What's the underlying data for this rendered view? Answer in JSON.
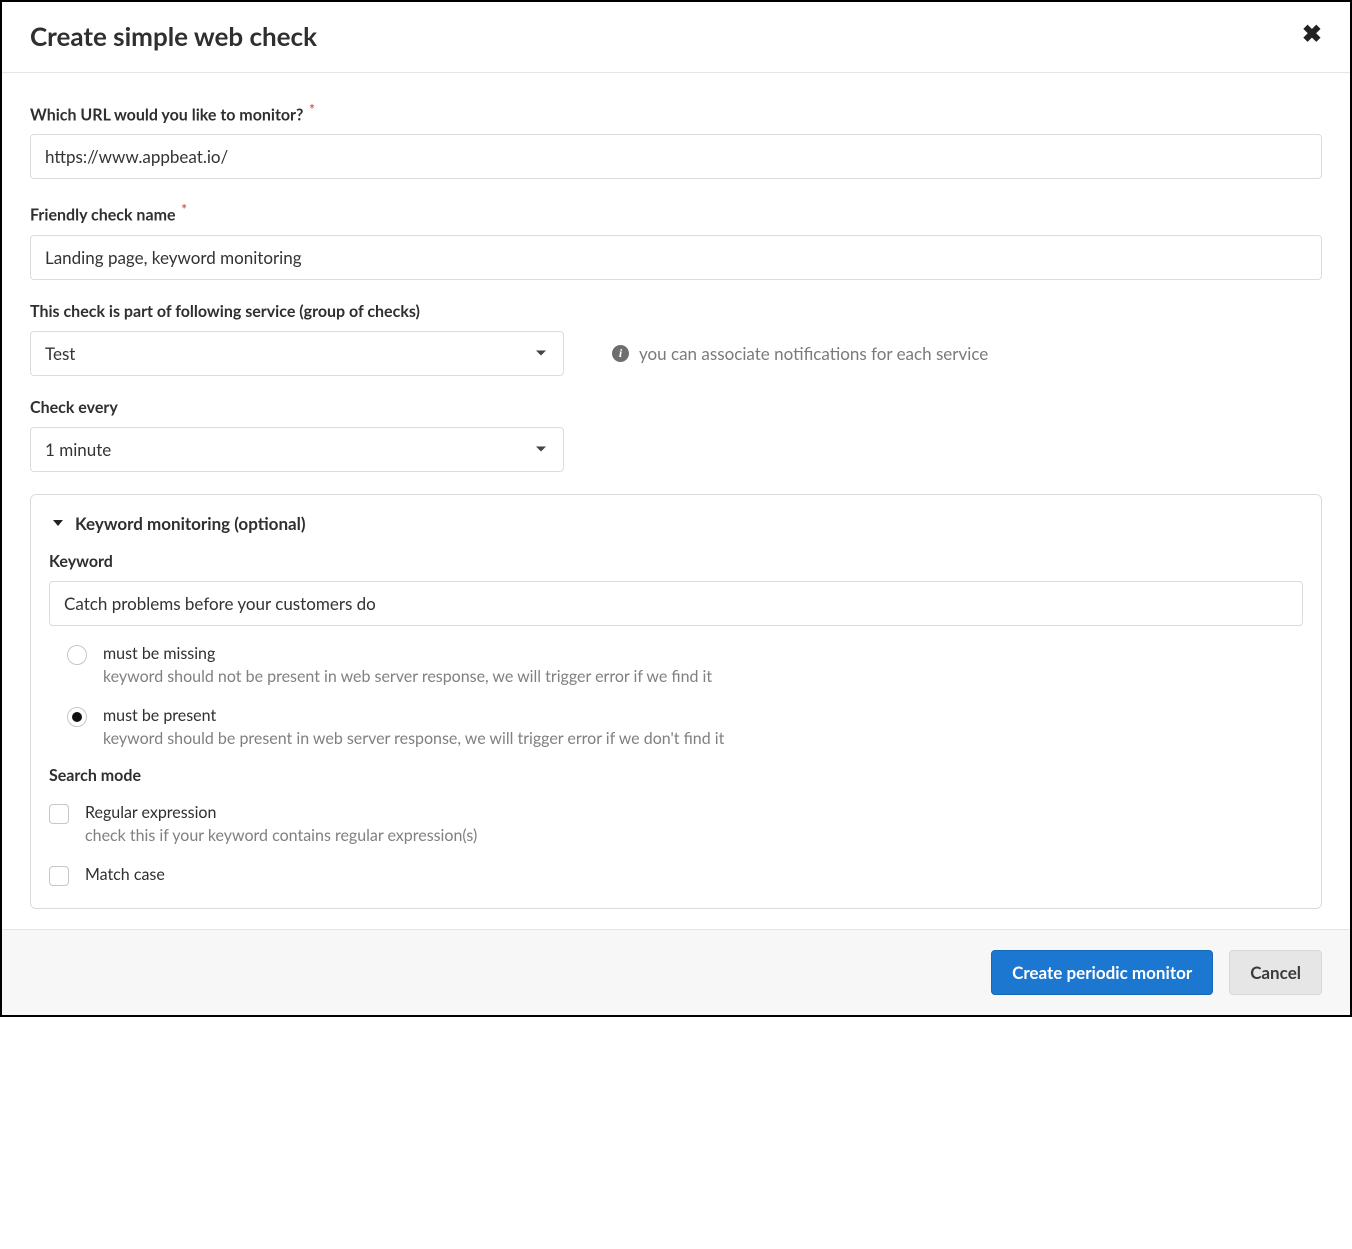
{
  "header": {
    "title": "Create simple web check"
  },
  "url": {
    "label": "Which URL would you like to monitor?",
    "required_mark": "*",
    "value": "https://www.appbeat.io/"
  },
  "friendly_name": {
    "label": "Friendly check name",
    "required_mark": "*",
    "value": "Landing page, keyword monitoring"
  },
  "service": {
    "label": "This check is part of following service (group of checks)",
    "value": "Test",
    "hint": "you can associate notifications for each service"
  },
  "frequency": {
    "label": "Check every",
    "value": "1 minute"
  },
  "keyword_panel": {
    "title": "Keyword monitoring (optional)",
    "keyword_label": "Keyword",
    "keyword_value": "Catch problems before your customers do",
    "radios": {
      "missing": {
        "label": "must be missing",
        "desc": "keyword should not be present in web server response, we will trigger error if we find it",
        "checked": false
      },
      "present": {
        "label": "must be present",
        "desc": "keyword should be present in web server response, we will trigger error if we don't find it",
        "checked": true
      }
    },
    "search_mode_label": "Search mode",
    "regex": {
      "label": "Regular expression",
      "desc": "check this if your keyword contains regular expression(s)"
    },
    "match_case": {
      "label": "Match case"
    }
  },
  "footer": {
    "primary": "Create periodic monitor",
    "cancel": "Cancel"
  }
}
